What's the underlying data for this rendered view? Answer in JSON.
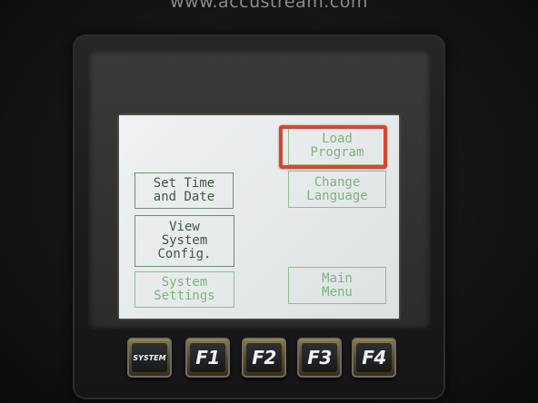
{
  "brand": {
    "url": "www.accustream.com"
  },
  "lcd": {
    "buttons": {
      "load_program": "Load\nProgram",
      "set_time_date": "Set Time\nand Date",
      "change_language": "Change\nLanguage",
      "view_system_config": "View\nSystem\nConfig.",
      "system_settings": "System\nSettings",
      "main_menu": "Main\nMenu"
    }
  },
  "keypad": {
    "keys": [
      "SYSTEM",
      "F1",
      "F2",
      "F3",
      "F4"
    ]
  },
  "colors": {
    "highlight": "#d8452f",
    "lcd_text_light": "#7fb37f",
    "lcd_text_dark": "#3f5a44",
    "key_bezel": "#8a7a3c"
  }
}
